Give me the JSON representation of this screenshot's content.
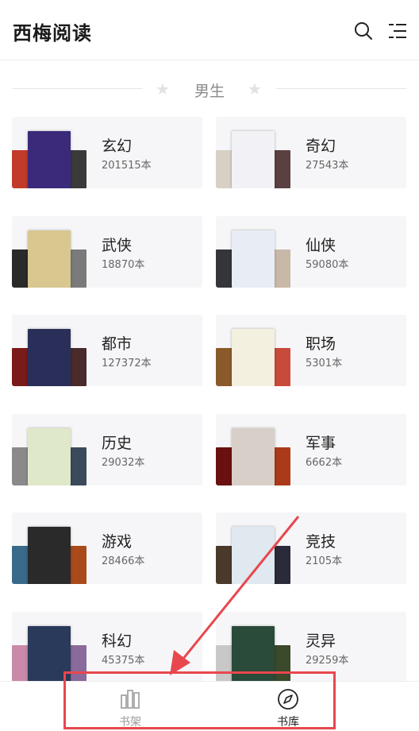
{
  "app": {
    "title": "西梅阅读"
  },
  "header": {
    "search_icon": "search-icon",
    "menu_icon": "menu-list-icon"
  },
  "section": {
    "title": "男生"
  },
  "categories": [
    {
      "name": "玄幻",
      "count": "201515本",
      "colors": [
        "#c23a2a",
        "#3b2a7a",
        "#3a3a3a"
      ]
    },
    {
      "name": "奇幻",
      "count": "27543本",
      "colors": [
        "#d8d0c4",
        "#f2f2f6",
        "#5a4040"
      ]
    },
    {
      "name": "武侠",
      "count": "18870本",
      "colors": [
        "#2a2a2a",
        "#d8c890",
        "#7a7a7a"
      ]
    },
    {
      "name": "仙侠",
      "count": "59080本",
      "colors": [
        "#34363a",
        "#e8ecf4",
        "#c8b8a8"
      ]
    },
    {
      "name": "都市",
      "count": "127372本",
      "colors": [
        "#7a1a1a",
        "#2a2f5a",
        "#4a2a2a"
      ]
    },
    {
      "name": "职场",
      "count": "5301本",
      "colors": [
        "#8a5a2a",
        "#f4f0e0",
        "#c84a3a"
      ]
    },
    {
      "name": "历史",
      "count": "29032本",
      "colors": [
        "#8a8a8a",
        "#dfe8c8",
        "#3a4a5a"
      ]
    },
    {
      "name": "军事",
      "count": "6662本",
      "colors": [
        "#6a1010",
        "#d8d0c8",
        "#aa3a1a"
      ]
    },
    {
      "name": "游戏",
      "count": "28466本",
      "colors": [
        "#3a6a8a",
        "#2a2a2a",
        "#aa4a1a"
      ]
    },
    {
      "name": "竞技",
      "count": "2105本",
      "colors": [
        "#4a3a2a",
        "#e0e8f0",
        "#2a2a3a"
      ]
    },
    {
      "name": "科幻",
      "count": "45375本",
      "colors": [
        "#c88aa8",
        "#2a3a5a",
        "#8a6a9a"
      ]
    },
    {
      "name": "灵异",
      "count": "29259本",
      "colors": [
        "#c8c8c8",
        "#2a4a3a",
        "#3a4a2a"
      ]
    }
  ],
  "tabbar": {
    "tabs": [
      {
        "label": "书架",
        "icon": "bookshelf-icon",
        "active": false
      },
      {
        "label": "书库",
        "icon": "compass-icon",
        "active": true
      }
    ]
  },
  "annotation": {
    "color": "#e8474e"
  }
}
